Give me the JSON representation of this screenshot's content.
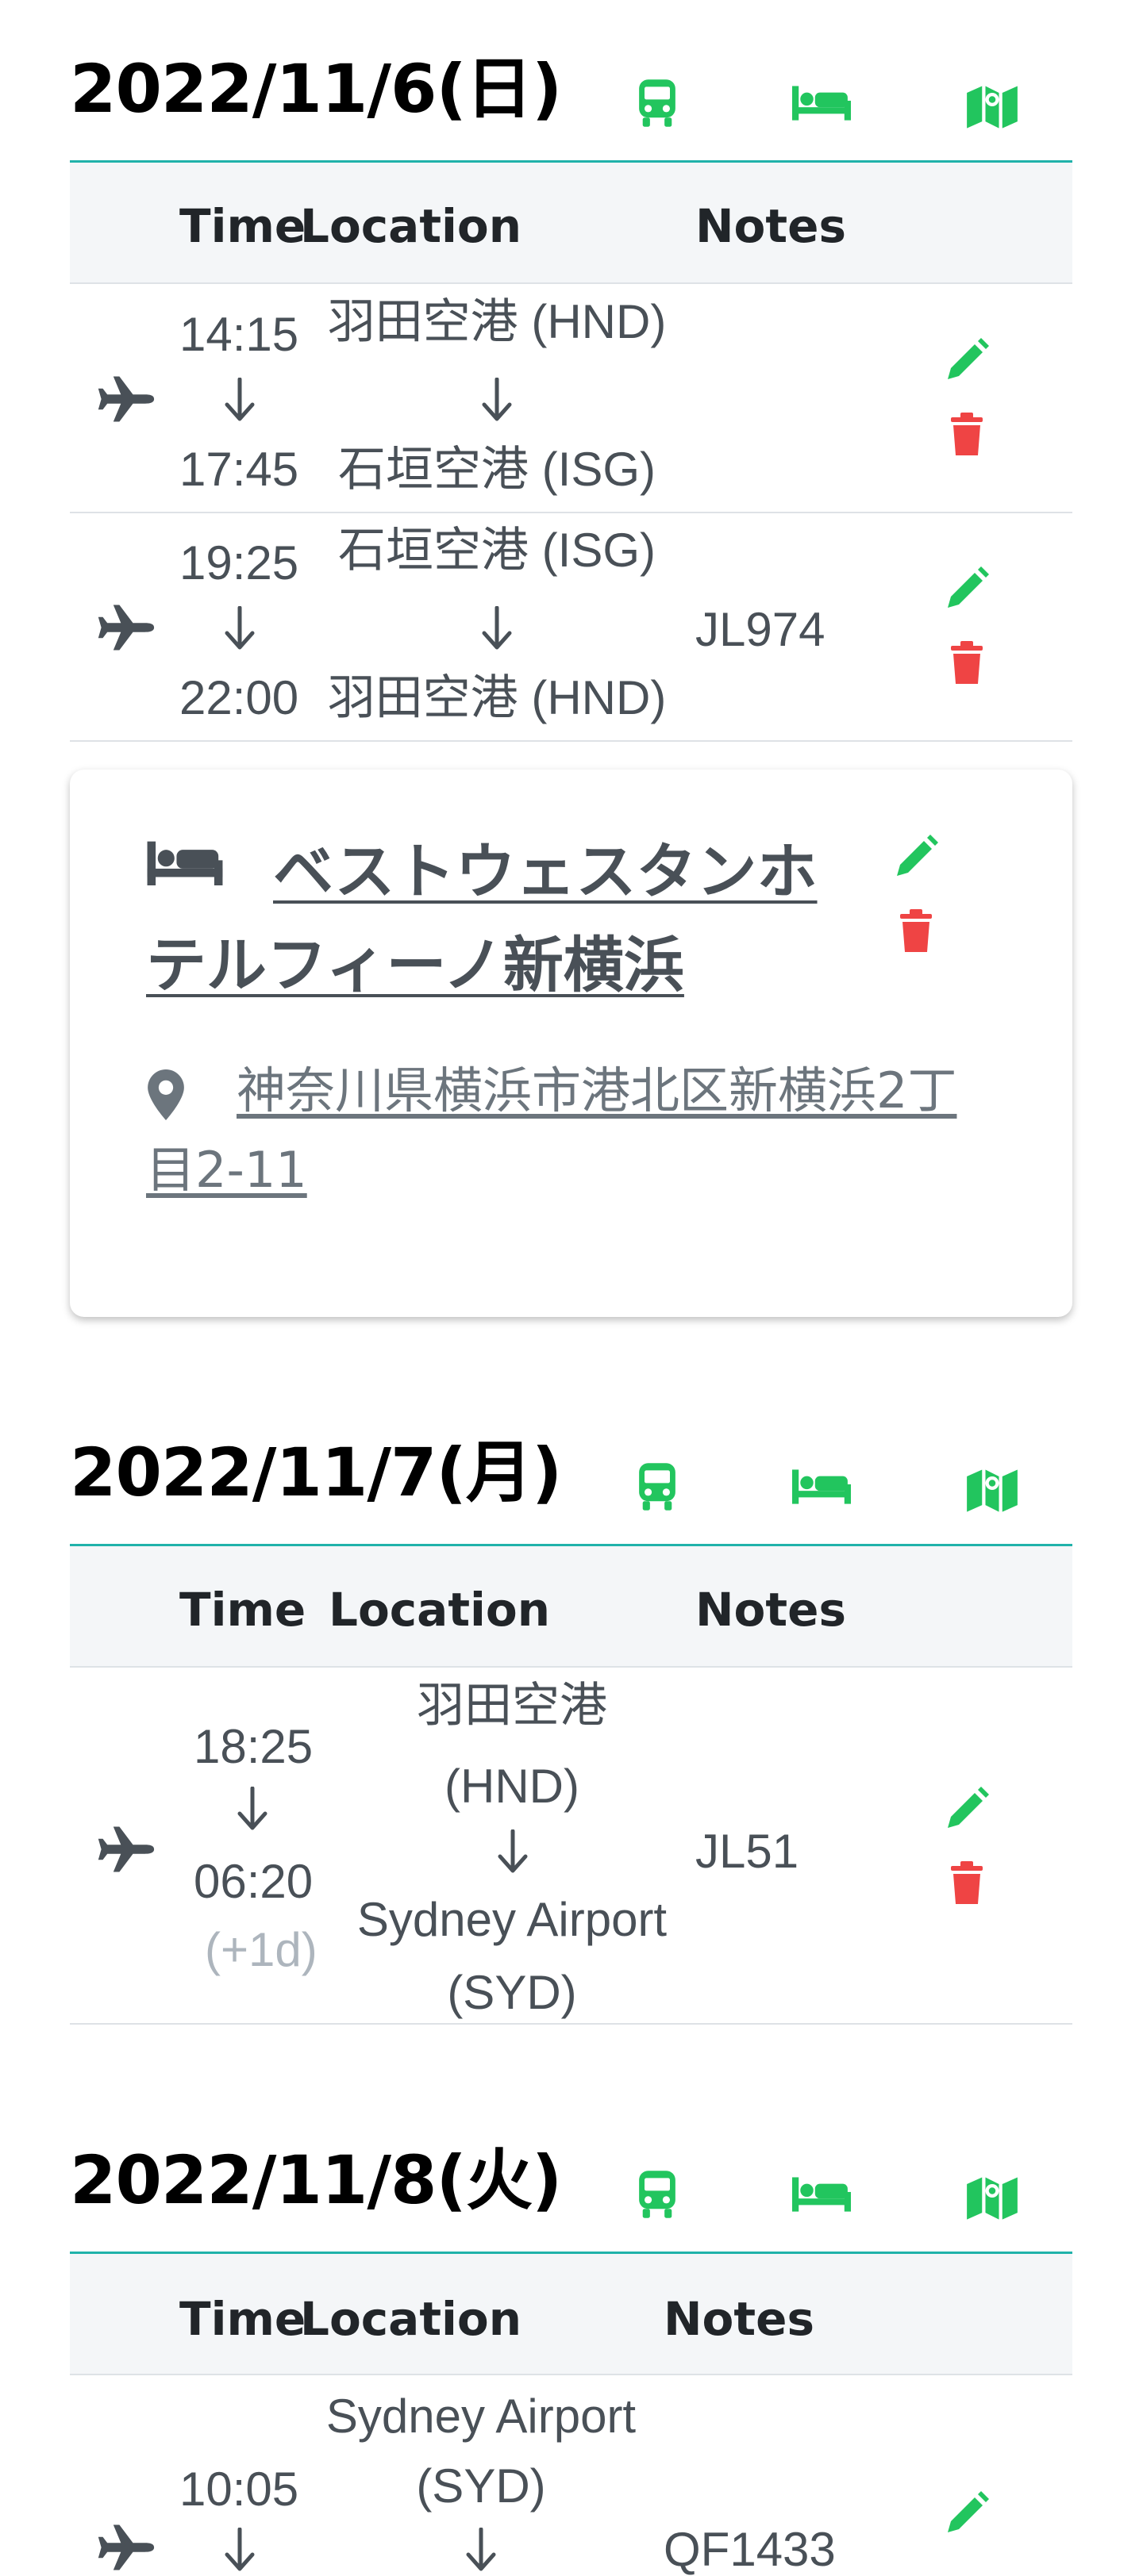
{
  "colors": {
    "accent_green": "#22c55e",
    "delete_red": "#ef4444",
    "divider_teal": "#20b2aa",
    "text_gray": "#495057",
    "muted_gray": "#adb5bd"
  },
  "days": [
    {
      "date": "2022/11/6(日)",
      "headers": {
        "time": "Time",
        "location": "Location",
        "notes": "Notes"
      },
      "rows": [
        {
          "type_icon": "plane-icon",
          "depart_time": "14:15",
          "arrive_time": "17:45",
          "from": "羽田空港 (HND)",
          "to": "石垣空港 (ISG)",
          "notes": ""
        },
        {
          "type_icon": "plane-icon",
          "depart_time": "19:25",
          "arrive_time": "22:00",
          "from": "石垣空港 (ISG)",
          "to": "羽田空港 (HND)",
          "notes": "JL974"
        }
      ],
      "hotel": {
        "name": "ベストウェスタンホテルフィーノ新横浜",
        "address": "神奈川県横浜市港北区新横浜2丁目2-11",
        "icon": "bed-icon",
        "address_icon": "map-pin-icon"
      }
    },
    {
      "date": "2022/11/7(月)",
      "headers": {
        "time": "Time",
        "location": "Location",
        "notes": "Notes"
      },
      "rows": [
        {
          "type_icon": "plane-icon",
          "depart_time": "18:25",
          "arrive_time": "06:20",
          "day_offset": "(+1d)",
          "from_line1": "羽田空港",
          "from_line2": "(HND)",
          "to_line1": "Sydney Airport",
          "to_line2": "(SYD)",
          "notes": "JL51"
        }
      ]
    },
    {
      "date": "2022/11/8(火)",
      "headers": {
        "time": "Time",
        "location": "Location",
        "notes": "Notes"
      },
      "rows": [
        {
          "type_icon": "plane-icon",
          "depart_time": "10:05",
          "from_line1": "Sydney Airport",
          "from_line2": "(SYD)",
          "notes": "QF1433"
        }
      ]
    }
  ],
  "day_actions": [
    "train-icon",
    "bed-icon",
    "map-icon"
  ]
}
